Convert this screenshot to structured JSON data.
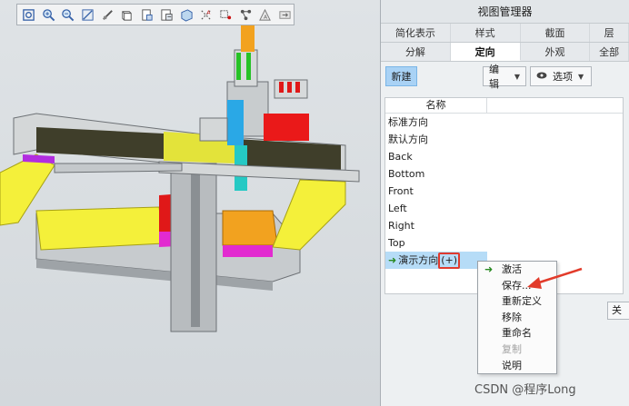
{
  "toolbar": {
    "icons": [
      "refit-icon",
      "zoom-in-icon",
      "zoom-out-icon",
      "repaint-icon",
      "spin-center-icon",
      "display-style-icon",
      "saved-views-icon",
      "view-manager-icon",
      "plane-display-icon",
      "axis-display-icon",
      "point-display-icon",
      "csys-display-icon",
      "annotation-icon",
      "spin-icon"
    ]
  },
  "panel": {
    "title": "视图管理器",
    "tabs_row1": [
      "简化表示",
      "样式",
      "截面",
      "层"
    ],
    "tabs_row2": [
      "分解",
      "定向",
      "外观",
      "全部"
    ],
    "active_tab": "定向",
    "new_label": "新建",
    "edit_label": "编辑",
    "options_label": "选项",
    "column_header": "名称",
    "items": [
      "标准方向",
      "默认方向",
      "Back",
      "Bottom",
      "Front",
      "Left",
      "Right",
      "Top"
    ],
    "selected_item_label": "演示方向",
    "selected_item_suffix": "(+)",
    "close_label": "关"
  },
  "context_menu": {
    "items": [
      "激活",
      "保存...",
      "重新定义",
      "移除",
      "重命名",
      "复制",
      "说明"
    ],
    "disabled": [
      "复制"
    ]
  },
  "watermark": "CSDN @程序Long"
}
